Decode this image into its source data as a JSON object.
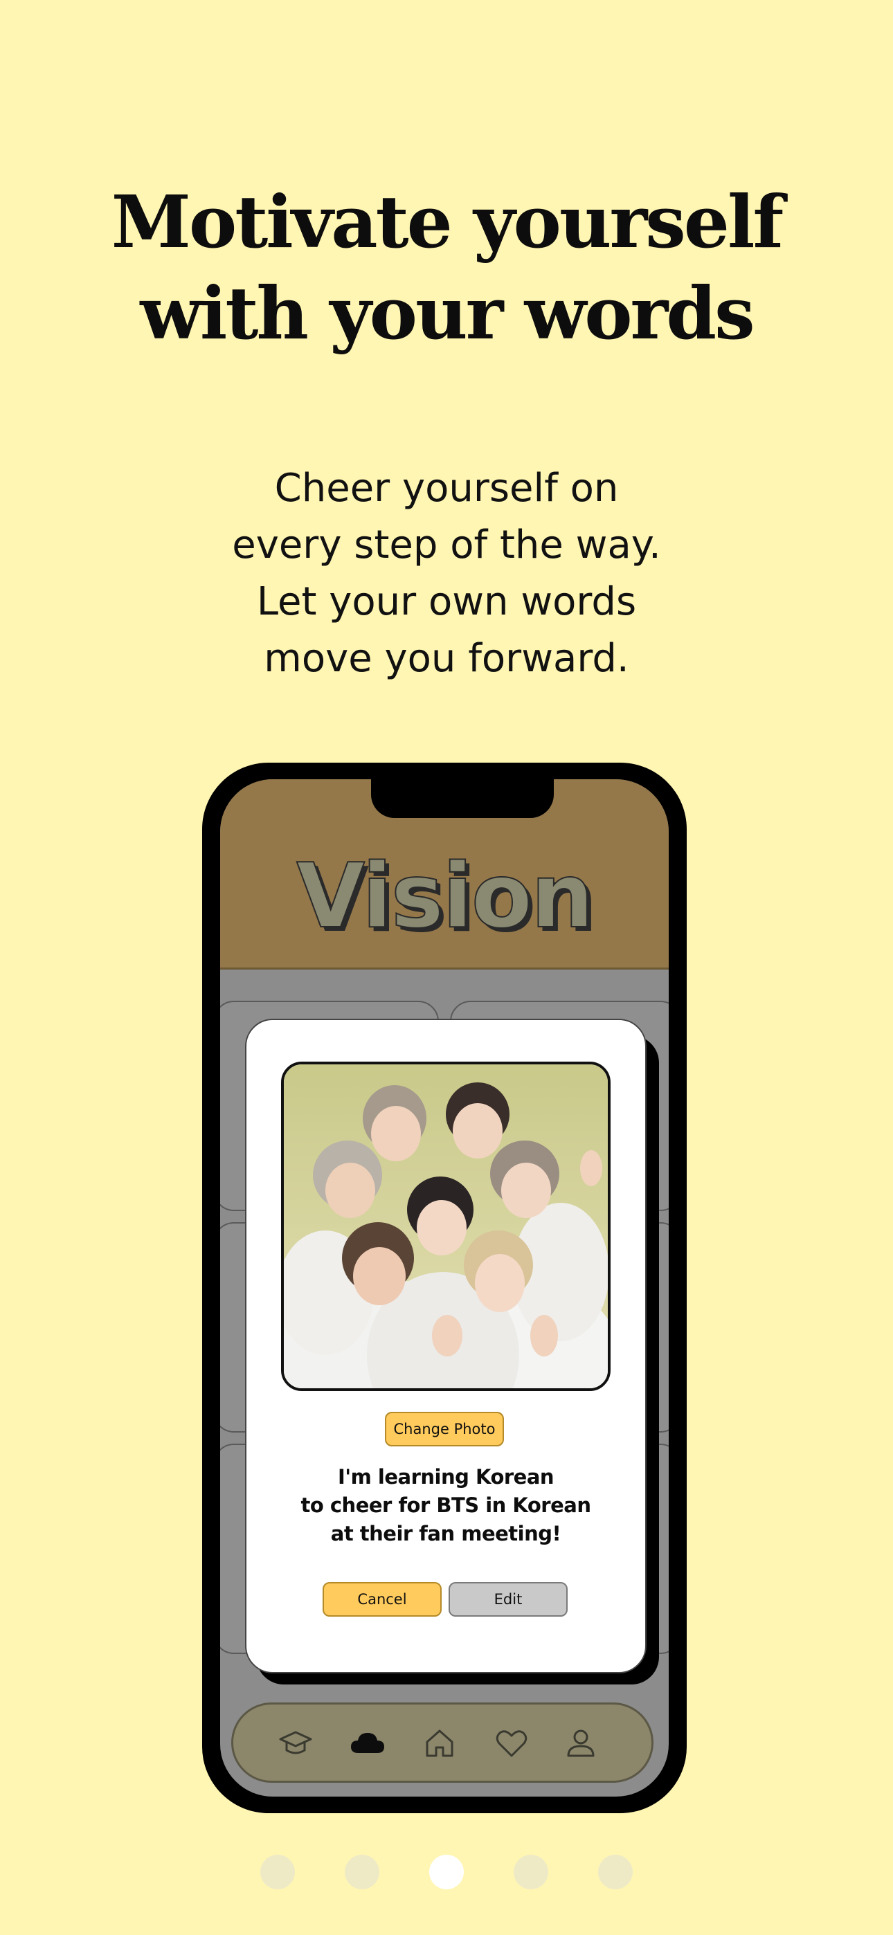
{
  "headline": [
    "Motivate yourself",
    "with your words"
  ],
  "subtext": [
    "Cheer yourself on",
    "every step of the way.",
    "Let your own words",
    "move you forward."
  ],
  "app": {
    "title": "Vision",
    "modal": {
      "change_photo_label": "Change Photo",
      "vision_lines": [
        "I'm learning Korean",
        "to cheer for BTS in Korean",
        "at their fan meeting!"
      ],
      "cancel_label": "Cancel",
      "edit_label": "Edit"
    },
    "tabs": [
      {
        "icon": "graduation-cap-icon",
        "active": false
      },
      {
        "icon": "cloud-icon",
        "active": true
      },
      {
        "icon": "home-icon",
        "active": false
      },
      {
        "icon": "heart-icon",
        "active": false
      },
      {
        "icon": "profile-icon",
        "active": false
      }
    ]
  },
  "pagination": {
    "total": 5,
    "current": 3
  },
  "colors": {
    "background": "#FFF6B3",
    "header": "#95784A",
    "accent_button": "#FFCB5C",
    "tabbar": "#8c876a"
  }
}
